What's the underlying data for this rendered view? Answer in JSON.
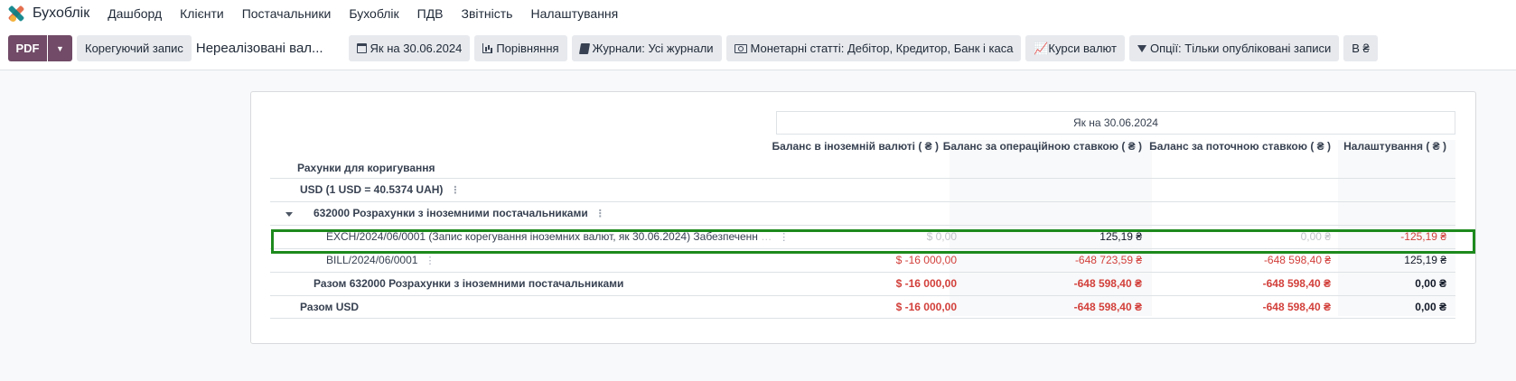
{
  "topnav": {
    "app_title": "Бухоблік",
    "menu": [
      "Дашборд",
      "Клієнти",
      "Постачальники",
      "Бухоблік",
      "ПДВ",
      "Звітність",
      "Налаштування"
    ]
  },
  "control_panel": {
    "pdf_label": "PDF",
    "adjust_button": "Корегуючий запис",
    "report_name": "Нереалізовані вал...",
    "filters": {
      "date": "Як на 30.06.2024",
      "comparison": "Порівняння",
      "journals": "Журнали: Усі журнали",
      "monetary": "Монетарні статті: Дебітор, Кредитор, Банк і каса",
      "rates": "Курси валют",
      "options": "Опції: Тільки опубліковані записи",
      "currency": "В ₴"
    }
  },
  "report": {
    "period_header": "Як на 30.06.2024",
    "columns": {
      "accounts": "Рахунки для коригування",
      "foreign": "Баланс в іноземній валюті ( ₴ )",
      "operation": "Баланс за операційною ставкою ( ₴ )",
      "current": "Баланс за поточною ставкою ( ₴ )",
      "adjustment": "Налаштування ( ₴ )"
    },
    "rows": [
      {
        "label": "USD (1 USD = 40.5374 UAH)",
        "foreign": "",
        "operation": "",
        "current": "",
        "adjustment": ""
      },
      {
        "label": "632000 Розрахунки з іноземними постачальниками",
        "foreign": "",
        "operation": "",
        "current": "",
        "adjustment": ""
      },
      {
        "label": "EXCH/2024/06/0001 (Запис корегування іноземних валют, як 30.06.2024) Забезпеченн",
        "foreign": "$ 0,00",
        "operation": "125,19 ₴",
        "current": "0,00 ₴",
        "adjustment": "-125,19 ₴"
      },
      {
        "label": "BILL/2024/06/0001",
        "foreign": "$ -16 000,00",
        "operation": "-648 723,59 ₴",
        "current": "-648 598,40 ₴",
        "adjustment": "125,19 ₴"
      },
      {
        "label": "Разом 632000 Розрахунки з іноземними постачальниками",
        "foreign": "$ -16 000,00",
        "operation": "-648 598,40 ₴",
        "current": "-648 598,40 ₴",
        "adjustment": "0,00 ₴"
      },
      {
        "label": "Разом USD",
        "foreign": "$ -16 000,00",
        "operation": "-648 598,40 ₴",
        "current": "-648 598,40 ₴",
        "adjustment": "0,00 ₴"
      }
    ]
  },
  "colors": {
    "primary": "#714b67",
    "negative": "#d23f3a",
    "highlight": "#1d8a1d"
  }
}
